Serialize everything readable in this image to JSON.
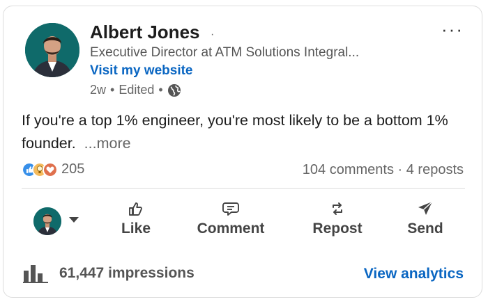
{
  "author": {
    "name": "Albert Jones",
    "name_separator": "·",
    "headline": "Executive Director at ATM Solutions Integral...",
    "website_link": "Visit my website",
    "meta": {
      "age": "2w",
      "sep1": "•",
      "edited": "Edited",
      "sep2": "•"
    }
  },
  "menu": {
    "more": "···"
  },
  "post": {
    "text": "If you're a top 1% engineer, you're most likely to be a bottom 1% founder.",
    "see_more": "...more"
  },
  "social": {
    "reaction_count": "205",
    "comments": "104 comments",
    "separator": "·",
    "reposts": "4 reposts",
    "reactions": [
      "like-reaction-icon",
      "insightful-reaction-icon",
      "love-reaction-icon"
    ]
  },
  "actions": {
    "like": "Like",
    "comment": "Comment",
    "repost": "Repost",
    "send": "Send"
  },
  "footer": {
    "impressions": "61,447 impressions",
    "view_analytics": "View analytics"
  },
  "colors": {
    "link_blue": "#0a66c2",
    "avatar_bg": "#0f6a6a",
    "like_blue": "#378fe9",
    "insightful_yellow": "#f5bb5c",
    "love_red": "#df704d"
  }
}
